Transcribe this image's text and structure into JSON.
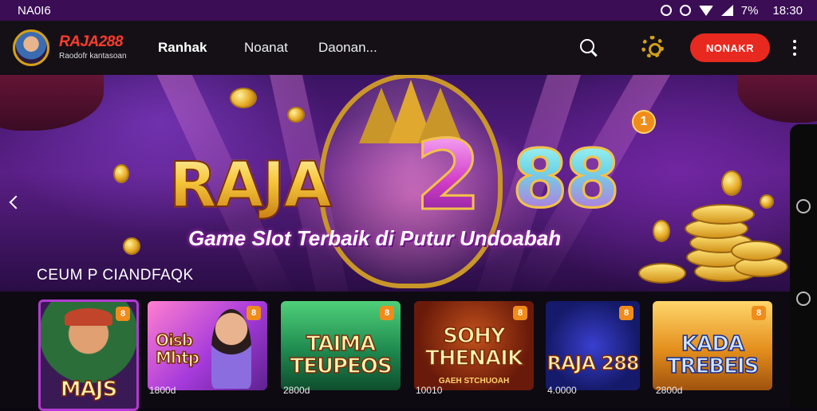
{
  "status_bar": {
    "left_text": "NA0I6",
    "battery_text": "7%",
    "time": "18:30"
  },
  "header": {
    "brand_name": "RAJA288",
    "brand_tagline": "Raodofr kantasoan",
    "nav": [
      "Ranhak",
      "Noanat",
      "Daonan..."
    ],
    "cta_label": "NONAKR"
  },
  "hero": {
    "title_part1": "RAJA",
    "title_part2": "2",
    "title_part3": "88",
    "badge": "1",
    "subtitle": "Game Slot Terbaik di Putur Undoabah",
    "section_label": "CEUM P CIANDFAQK"
  },
  "games": [
    {
      "title": "MAJS",
      "tag": "8",
      "count": ""
    },
    {
      "title": "Oisb Mhtp",
      "tag": "8",
      "count": "1800d"
    },
    {
      "title": "TAIMA TEUPEOS",
      "tag": "8",
      "count": "2800d"
    },
    {
      "title": "SOHY THENAIK",
      "tag": "8",
      "count": "10010",
      "subtitle": "GAEH STCHUOAH"
    },
    {
      "title": "RAJA 288",
      "tag": "8",
      "count": "4.0000"
    },
    {
      "title": "KADA TREBEIS",
      "tag": "8",
      "count": "2800d"
    }
  ],
  "colors": {
    "accent": "#e8291f",
    "brand_purple": "#3a0d55",
    "gold": "#d4a017"
  }
}
